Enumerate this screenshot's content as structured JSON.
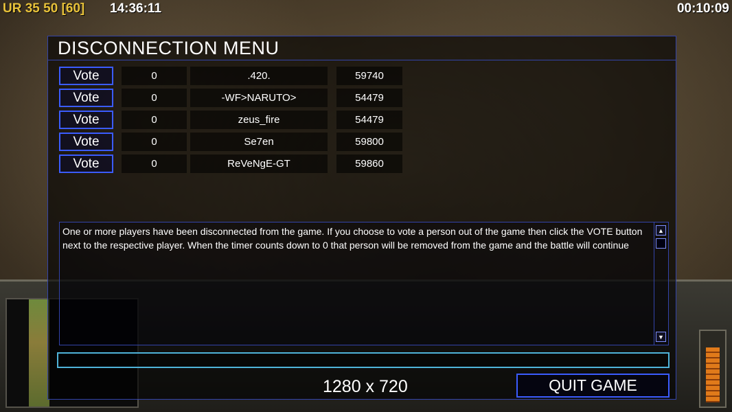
{
  "hud": {
    "fps": "UR 35 50 [60]",
    "clock": "14:36:11",
    "game_timer": "00:10:09"
  },
  "dialog": {
    "title": "DISCONNECTION MENU",
    "players": [
      {
        "vote_label": "Vote",
        "count": "0",
        "name": ".420.",
        "ping": "59740"
      },
      {
        "vote_label": "Vote",
        "count": "0",
        "name": "-WF>NARUTO>",
        "ping": "54479"
      },
      {
        "vote_label": "Vote",
        "count": "0",
        "name": "zeus_fire",
        "ping": "54479"
      },
      {
        "vote_label": "Vote",
        "count": "0",
        "name": "Se7en",
        "ping": "59800"
      },
      {
        "vote_label": "Vote",
        "count": "0",
        "name": "ReVeNgE-GT",
        "ping": "59860"
      }
    ],
    "message": "One or more players have been disconnected from the game. If you choose to vote a person out of the game then click the VOTE button next to the respective player. When the timer counts down to 0 that person will be removed from the game and the battle will continue",
    "chat_value": "",
    "resolution": "1280 x 720",
    "quit_label": "QUIT GAME"
  },
  "colors": {
    "accent_border": "#3b5cff",
    "input_border": "#4fb3d9",
    "fps_color": "#e8c23a"
  }
}
